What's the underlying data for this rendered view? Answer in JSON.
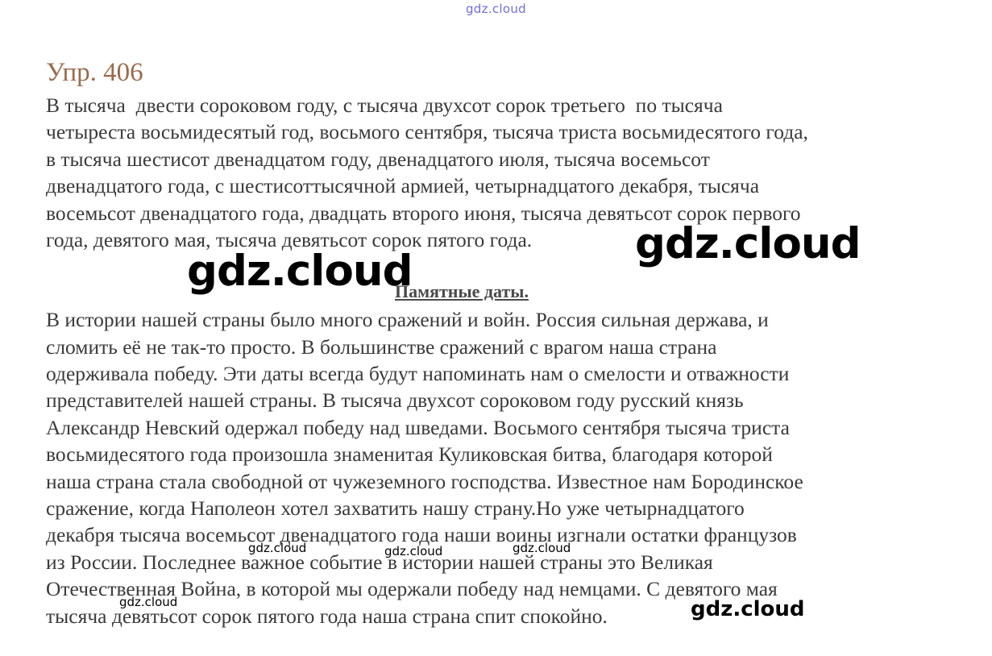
{
  "watermarks": {
    "top": "gdz.cloud",
    "large_right": "gdz.cloud",
    "large_left": "gdz.cloud",
    "small_1": "gdz.cloud",
    "small_2": "gdz.cloud",
    "small_3": "gdz.cloud",
    "small_4": "gdz.cloud",
    "bottom_right": "gdz.cloud"
  },
  "exercise": {
    "title": "Упр. 406",
    "paragraph1": [
      "В тысяча  двести сороковом году, с тысяча двухсот сорок третьего  по тысяча",
      "четыреста восьмидесятый год, восьмого сентября, тысяча триста восьмидесятого года,",
      "в тысяча шестисот двенадцатом году, двенадцатого июля, тысяча восемьсот",
      "двенадцатого года, с шестисоттысячной армией, четырнадцатого декабря, тысяча",
      "восемьсот двенадцатого года, двадцать второго июня, тысяча девятьсот сорок первого",
      "года, девятого мая, тысяча девятьсот сорок пятого года."
    ],
    "heading": "Памятные даты.",
    "paragraph2": [
      "В истории нашей страны было много сражений и войн. Россия сильная держава, и",
      "сломить её не так-то просто. В большинстве сражений с врагом наша страна",
      "одерживала победу. Эти даты всегда будут напоминать нам о смелости и отважности",
      "представителей нашей страны. В тысяча двухсот сороковом году русский князь",
      "Александр Невский одержал победу над шведами. Восьмого сентября тысяча триста",
      "восьмидесятого года произошла знаменитая Куликовская битва, благодаря которой",
      "наша страна стала свободной от чужеземного господства. Известное нам Бородинское",
      "сражение, когда Наполеон хотел захватить нашу страну.Но уже четырнадцатого",
      "декабря тысяча восемьсот двенадцатого года наши воины изгнали остатки французов",
      "из России. Последнее важное событие в истории нашей страны это Великая",
      "Отечественная Война, в которой мы одержали победу над немцами. С девятого мая",
      "тысяча девятьсот сорок пятого года наша страна спит спокойно."
    ]
  }
}
